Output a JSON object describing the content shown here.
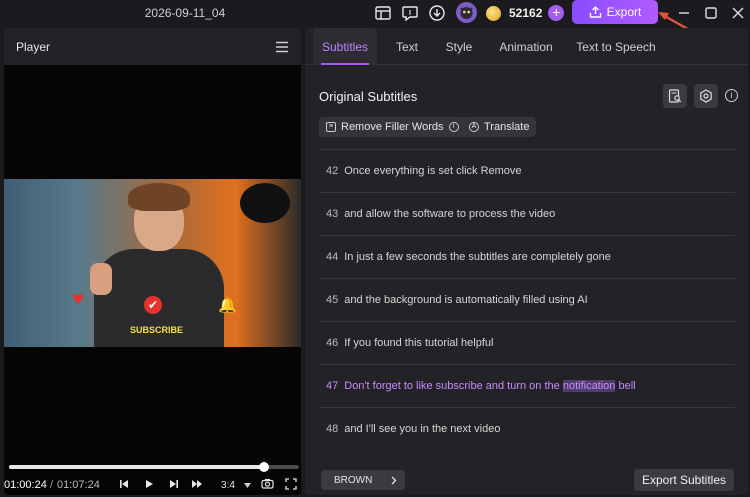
{
  "window": {
    "title": "2026-09-11_04"
  },
  "header": {
    "coins": "52162",
    "plus": "+",
    "export_label": "Export"
  },
  "player": {
    "label": "Player",
    "video_overlay_text": "SUBSCRIBE",
    "time_current": "01:00:24",
    "time_separator": "/",
    "time_total": "01:07:24",
    "aspect": "3:4",
    "progress": 0.88
  },
  "tabs": [
    {
      "label": "Subtitles",
      "active": true
    },
    {
      "label": "Text",
      "active": false
    },
    {
      "label": "Style",
      "active": false
    },
    {
      "label": "Animation",
      "active": false
    },
    {
      "label": "Text to Speech",
      "active": false
    }
  ],
  "subtitles": {
    "section_title": "Original Subtitles",
    "remove_filler": "Remove Filler Words",
    "translate": "Translate",
    "rows": [
      {
        "num": "42",
        "text": "Once everything is set click Remove"
      },
      {
        "num": "43",
        "text": "and allow the software to process the video"
      },
      {
        "num": "44",
        "text": "In just a few seconds the subtitles are completely gone"
      },
      {
        "num": "45",
        "text": "and the background is automatically filled using AI"
      },
      {
        "num": "46",
        "text": "If you found this tutorial helpful"
      },
      {
        "num": "47",
        "text_before": "Don't forget to like subscribe and turn on the",
        "highlight": "notification",
        "text_after": "bell",
        "active": true
      },
      {
        "num": "48",
        "text": "and I'll see you in the next video"
      }
    ],
    "style_select": "BROWN",
    "export_subtitles": "Export Subtitles"
  },
  "colors": {
    "accent": "#a45cf0",
    "active_text": "#c68bff",
    "arrow": "#e0553a"
  }
}
